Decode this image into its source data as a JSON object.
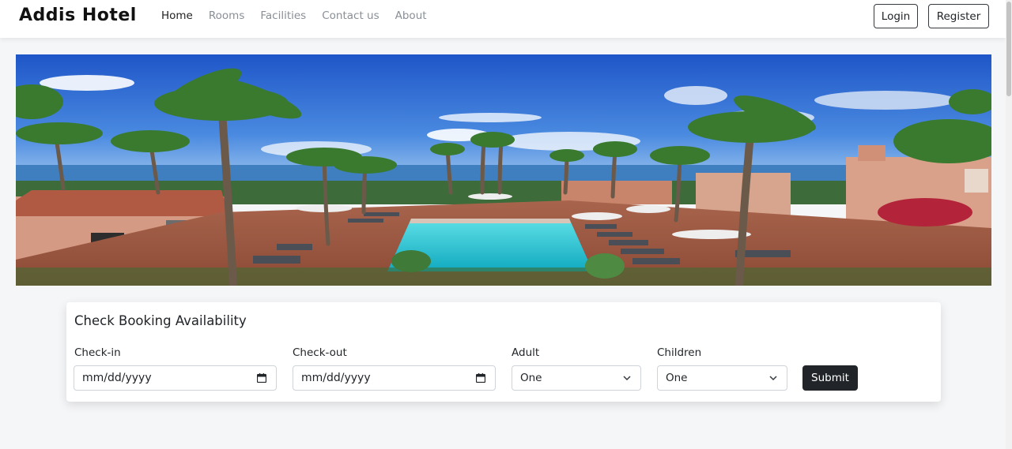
{
  "navbar": {
    "brand": "Addis Hotel",
    "links": [
      {
        "label": "Home",
        "active": true
      },
      {
        "label": "Rooms",
        "active": false
      },
      {
        "label": "Facilities",
        "active": false
      },
      {
        "label": "Contact us",
        "active": false
      },
      {
        "label": "About",
        "active": false
      }
    ],
    "login_label": "Login",
    "register_label": "Register"
  },
  "hero": {
    "image_desc": "hotel-pool-palm-trees-photo"
  },
  "booking": {
    "title": "Check Booking Availability",
    "checkin": {
      "label": "Check-in",
      "value": "mm/dd/yyyy"
    },
    "checkout": {
      "label": "Check-out",
      "value": "mm/dd/yyyy"
    },
    "adult": {
      "label": "Adult",
      "value": "One"
    },
    "children": {
      "label": "Children",
      "value": "One"
    },
    "submit_label": "Submit"
  },
  "colors": {
    "accent_dark": "#212529",
    "page_bg": "#f5f6f8",
    "pool": "#2ec4d0"
  }
}
